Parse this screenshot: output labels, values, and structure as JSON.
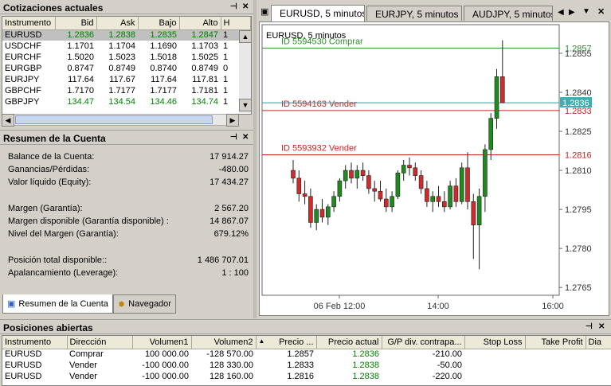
{
  "quotes": {
    "title": "Cotizaciones actuales",
    "columns": [
      "Instrumento",
      "Bid",
      "Ask",
      "Bajo",
      "Alto",
      "H"
    ],
    "rows": [
      {
        "sym": "EURUSD",
        "bid": "1.2836",
        "ask": "1.2838",
        "low": "1.2835",
        "high": "1.2847",
        "h": "1",
        "green": true,
        "selected": true
      },
      {
        "sym": "USDCHF",
        "bid": "1.1701",
        "ask": "1.1704",
        "low": "1.1690",
        "high": "1.1703",
        "h": "1",
        "green": false
      },
      {
        "sym": "EURCHF",
        "bid": "1.5020",
        "ask": "1.5023",
        "low": "1.5018",
        "high": "1.5025",
        "h": "1",
        "green": false
      },
      {
        "sym": "EURGBP",
        "bid": "0.8747",
        "ask": "0.8749",
        "low": "0.8740",
        "high": "0.8749",
        "h": "0",
        "green": false
      },
      {
        "sym": "EURJPY",
        "bid": "117.64",
        "ask": "117.67",
        "low": "117.64",
        "high": "117.81",
        "h": "1",
        "green": false
      },
      {
        "sym": "GBPCHF",
        "bid": "1.7170",
        "ask": "1.7177",
        "low": "1.7177",
        "high": "1.7181",
        "h": "1",
        "green": false
      },
      {
        "sym": "GBPJPY",
        "bid": "134.47",
        "ask": "134.54",
        "low": "134.46",
        "high": "134.74",
        "h": "1",
        "green": true
      }
    ]
  },
  "account": {
    "title": "Resumen de la Cuenta",
    "rows": [
      {
        "label": "Balance de la Cuenta:",
        "value": "17 914.27"
      },
      {
        "label": "Ganancias/Pérdidas:",
        "value": "-480.00"
      },
      {
        "label": "Valor líquido (Equity):",
        "value": "17 434.27"
      },
      {
        "label": "Margen (Garantía):",
        "value": "2 567.20"
      },
      {
        "label": "Margen disponible (Garantía disponible) :",
        "value": "14 867.07"
      },
      {
        "label": "Nivel del Margen (Garantía):",
        "value": "679.12%"
      },
      {
        "label": "Posición total disponible::",
        "value": "1 486 707.01"
      },
      {
        "label": "Apalancamiento (Leverage):",
        "value": "1 : 100"
      }
    ],
    "tab_summary": "Resumen de la Cuenta",
    "tab_navigator": "Navegador"
  },
  "chart_tabs": [
    "EURUSD, 5 minutos",
    "EURJPY, 5 minutos",
    "AUDJPY, 5 minutos"
  ],
  "chart": {
    "label": "EURUSD, 5 minutos",
    "y_ticks": [
      "1.2855",
      "1.2840",
      "1.2825",
      "1.2810",
      "1.2795",
      "1.2780",
      "1.2765"
    ],
    "x_ticks": [
      "06 Feb 12:00",
      "14:00",
      "16:00"
    ],
    "lines": [
      {
        "label": "ID 5594530 Comprar",
        "price": "1.2857",
        "color": "#2e8b2e"
      },
      {
        "label": "ID 5594163 Vender",
        "price": "1.2833",
        "color": "#cc2222"
      },
      {
        "label": "ID 5593932 Vender",
        "price": "1.2816",
        "color": "#cc2222"
      }
    ],
    "current_price": "1.2836"
  },
  "chart_data": {
    "type": "candlestick",
    "ylim": [
      1.2762,
      1.2866
    ],
    "candles": [
      [
        1.281,
        1.2814,
        1.2805,
        1.2807
      ],
      [
        1.2807,
        1.281,
        1.2798,
        1.2801
      ],
      [
        1.2801,
        1.2806,
        1.2797,
        1.28
      ],
      [
        1.28,
        1.2803,
        1.2788,
        1.279
      ],
      [
        1.279,
        1.2797,
        1.2787,
        1.2795
      ],
      [
        1.2795,
        1.2799,
        1.279,
        1.2792
      ],
      [
        1.2792,
        1.2797,
        1.2789,
        1.2796
      ],
      [
        1.2796,
        1.2802,
        1.2794,
        1.28
      ],
      [
        1.28,
        1.2807,
        1.2798,
        1.2806
      ],
      [
        1.2806,
        1.2812,
        1.2803,
        1.281
      ],
      [
        1.281,
        1.2813,
        1.2805,
        1.2807
      ],
      [
        1.2807,
        1.2812,
        1.2803,
        1.281
      ],
      [
        1.281,
        1.2813,
        1.2806,
        1.2808
      ],
      [
        1.2808,
        1.281,
        1.2801,
        1.2803
      ],
      [
        1.2803,
        1.2806,
        1.2798,
        1.2802
      ],
      [
        1.2802,
        1.2806,
        1.2798,
        1.2799
      ],
      [
        1.2799,
        1.2803,
        1.2794,
        1.2796
      ],
      [
        1.2796,
        1.2802,
        1.2794,
        1.28
      ],
      [
        1.28,
        1.281,
        1.2799,
        1.2809
      ],
      [
        1.2809,
        1.2814,
        1.2806,
        1.2812
      ],
      [
        1.2812,
        1.2815,
        1.2808,
        1.2811
      ],
      [
        1.2811,
        1.2813,
        1.2806,
        1.2808
      ],
      [
        1.2808,
        1.281,
        1.2801,
        1.2803
      ],
      [
        1.2803,
        1.2806,
        1.2796,
        1.2798
      ],
      [
        1.2798,
        1.2802,
        1.2794,
        1.28
      ],
      [
        1.28,
        1.2804,
        1.2796,
        1.2798
      ],
      [
        1.2798,
        1.2802,
        1.2794,
        1.2796
      ],
      [
        1.2796,
        1.2806,
        1.2795,
        1.2804
      ],
      [
        1.2804,
        1.2807,
        1.2796,
        1.2798
      ],
      [
        1.2798,
        1.2813,
        1.2797,
        1.2811
      ],
      [
        1.2811,
        1.2817,
        1.2795,
        1.2798
      ],
      [
        1.2798,
        1.2801,
        1.2776,
        1.2789
      ],
      [
        1.2789,
        1.2803,
        1.2772,
        1.28
      ],
      [
        1.28,
        1.282,
        1.2794,
        1.2818
      ],
      [
        1.2818,
        1.2832,
        1.2814,
        1.283
      ],
      [
        1.283,
        1.2849,
        1.2826,
        1.2846
      ],
      [
        1.2846,
        1.286,
        1.2838,
        1.2836
      ]
    ]
  },
  "positions": {
    "title": "Posiciones abiertas",
    "columns": [
      "Instrumento",
      "Dirección",
      "Volumen1",
      "Volumen2",
      "Precio ...",
      "Precio actual",
      "G/P div. contrapa...",
      "Stop Loss",
      "Take Profit",
      "Dia"
    ],
    "rows": [
      {
        "sym": "EURUSD",
        "dir": "Comprar",
        "v1": "100 000.00",
        "v2": "-128 570.00",
        "price": "1.2857",
        "cur": "1.2836",
        "pl": "-210.00"
      },
      {
        "sym": "EURUSD",
        "dir": "Vender",
        "v1": "-100 000.00",
        "v2": "128 330.00",
        "price": "1.2833",
        "cur": "1.2838",
        "pl": "-50.00"
      },
      {
        "sym": "EURUSD",
        "dir": "Vender",
        "v1": "-100 000.00",
        "v2": "128 160.00",
        "price": "1.2816",
        "cur": "1.2838",
        "pl": "-220.00"
      }
    ]
  },
  "icons": {
    "pin": "pin-icon",
    "close": "close-icon",
    "menu": "dropdown-arrow-icon"
  }
}
